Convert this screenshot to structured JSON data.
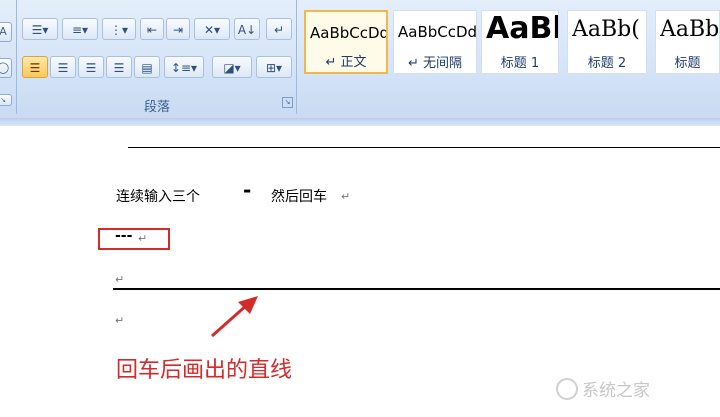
{
  "ribbon": {
    "paragraph_group_label": "段落",
    "styles": [
      {
        "sample": "AaBbCcDd",
        "label": "↵ 正文"
      },
      {
        "sample": "AaBbCcDd",
        "label": "↵ 无间隔"
      },
      {
        "sample": "AaBl",
        "label": "标题 1"
      },
      {
        "sample": "AaBb(",
        "label": "标题 2"
      },
      {
        "sample": "AaBb",
        "label": "标题"
      }
    ]
  },
  "document": {
    "line1_text": "连续输入三个",
    "line1_dash": "-",
    "line1_tail": "然后回车",
    "paragraph_mark": "↵",
    "typed_dashes": "---",
    "caption": "回车后画出的直线"
  },
  "watermark": {
    "text": "系统之家"
  },
  "colors": {
    "annotation_red": "#d42a2a",
    "selected_style_border": "#f0b84a"
  }
}
